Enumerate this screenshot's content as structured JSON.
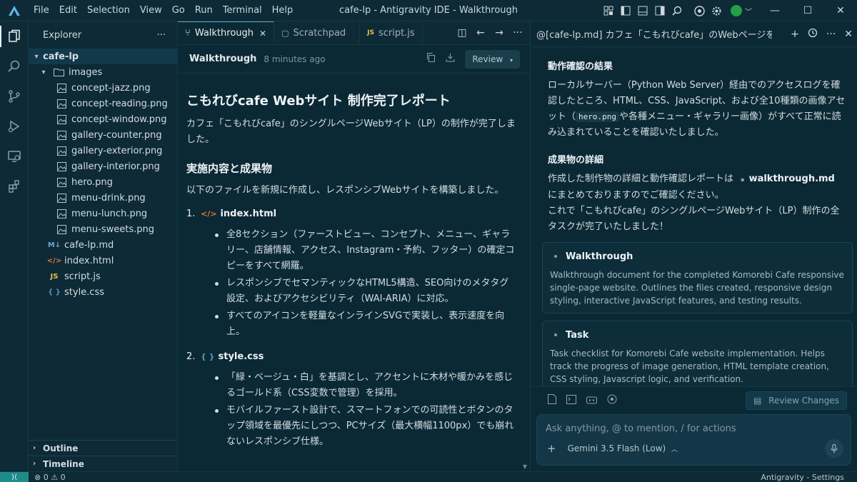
{
  "titlebar": {
    "menu": [
      "File",
      "Edit",
      "Selection",
      "View",
      "Go",
      "Run",
      "Terminal",
      "Help"
    ],
    "title": "cafe-lp - Antigravity IDE - Walkthrough",
    "minimize": "—",
    "maximize": "☐",
    "close": "✕"
  },
  "sidebar": {
    "header": "Explorer",
    "more": "···",
    "root": "cafe-lp",
    "images_folder": "images",
    "image_files": [
      "concept-jazz.png",
      "concept-reading.png",
      "concept-window.png",
      "gallery-counter.png",
      "gallery-exterior.png",
      "gallery-interior.png",
      "hero.png",
      "menu-drink.png",
      "menu-lunch.png",
      "menu-sweets.png"
    ],
    "root_files": [
      {
        "name": "cafe-lp.md",
        "badge": "M↓",
        "color": "#6aa7c9"
      },
      {
        "name": "index.html",
        "badge": "</>",
        "color": "#e37933"
      },
      {
        "name": "script.js",
        "badge": "JS",
        "color": "#e8c14a"
      },
      {
        "name": "style.css",
        "badge": "{ }",
        "color": "#519aba"
      }
    ],
    "outline": "Outline",
    "timeline": "Timeline"
  },
  "editor": {
    "tabs": [
      {
        "label": "Walkthrough",
        "icon": "⑂",
        "close": "✕"
      },
      {
        "label": "Scratchpad",
        "icon": "▢"
      },
      {
        "label": "script.js",
        "icon": "JS"
      }
    ],
    "doc_title": "Walkthrough",
    "doc_time": "8 minutes ago",
    "review_label": "Review",
    "h1": "こもれびcafe Webサイト 制作完了レポート",
    "intro": "カフェ「こもれびcafe」のシングルページWebサイト（LP）の制作が完了しました。",
    "h2": "実施内容と成果物",
    "lead": "以下のファイルを新規に作成し、レスポンシブWebサイトを構築しました。",
    "items": [
      {
        "num": "1.",
        "icon": "</>",
        "title": "index.html",
        "bullets": [
          "全8セクション（ファーストビュー、コンセプト、メニュー、ギャラリー、店舗情報、アクセス、Instagram・予約、フッター）の確定コピーをすべて網羅。",
          "レスポンシブでセマンティックなHTML5構造、SEO向けのメタタグ設定、およびアクセシビリティ（WAI-ARIA）に対応。",
          "すべてのアイコンを軽量なインラインSVGで実装し、表示速度を向上。"
        ]
      },
      {
        "num": "2.",
        "icon": "{ }",
        "title": "style.css",
        "bullets": [
          "「緑・ベージュ・白」を基調とし、アクセントに木材や暖かみを感じるゴールド系（CSS変数で管理）を採用。",
          "モバイルファースト設計で、スマートフォンでの可読性とボタンのタップ領域を最優先にしつつ、PCサイズ（最大横幅1100px）でも崩れないレスポンシブ仕様。"
        ]
      }
    ]
  },
  "panel": {
    "title": "@[cafe-lp.md] カフェ「こもれびcafe」のWebページをf",
    "h_result": "動作確認の結果",
    "p_result_1": "ローカルサーバー（Python Web Server）経由でのアクセスログを確認したところ、HTML、CSS、JavaScript、および全10種類の画像アセット（",
    "p_result_code": "hero.png",
    "p_result_2": "や各種メニュー・ギャラリー画像）がすべて正常に読み込まれていることを確認いたしました。",
    "h_detail": "成果物の詳細",
    "p_detail_1": "作成した制作物の詳細と動作確認レポートは ",
    "p_detail_file": "walkthrough.md",
    "p_detail_2": " にまとめておりますのでご確認ください。",
    "p_detail_3": "これで「こもれびcafe」のシングルページWebサイト（LP）制作の全タスクが完了いたしました！",
    "cards": [
      {
        "title": "Walkthrough",
        "desc": "Walkthrough document for the completed Komorebi Cafe responsive single-page website. Outlines the files created, responsive design styling, interactive JavaScript features, and testing results."
      },
      {
        "title": "Task",
        "desc": "Task checklist for Komorebi Cafe website implementation. Helps track the progress of image generation, HTML template creation, CSS styling, Javascript logic, and verification."
      }
    ],
    "review_changes": "Review Changes",
    "input_placeholder": "Ask anything, @ to mention, / for actions",
    "add": "+",
    "model": "Gemini 3.5 Flash (Low)"
  },
  "statusbar": {
    "problems": "⊗ 0 ⚠ 0",
    "right": "Antigravity - Settings"
  },
  "colors": {
    "background": "#0b2935",
    "chrome": "#0d2a36",
    "accent": "#6aa7c9",
    "remote": "#1e8a8a"
  }
}
